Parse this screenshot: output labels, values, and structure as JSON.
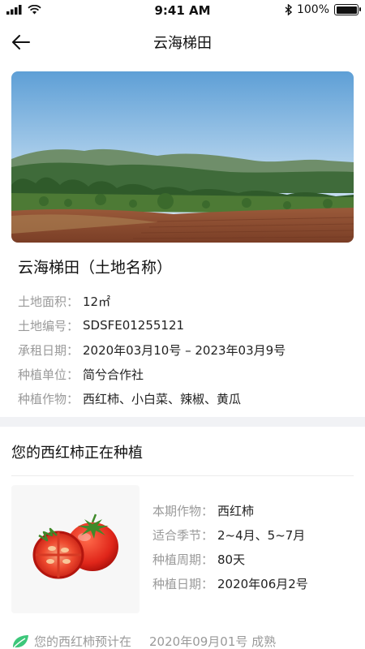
{
  "status": {
    "time": "9:41 AM",
    "battery": "100%",
    "battery_level": 1.0,
    "icons": [
      "signal-icon",
      "wifi-icon",
      "bluetooth-icon",
      "battery-icon"
    ]
  },
  "nav": {
    "title": "云海梯田",
    "back_icon": "back-arrow-icon"
  },
  "land": {
    "title": "云海梯田（土地名称）",
    "fields": [
      {
        "label": "土地面积：",
        "value": "12㎡"
      },
      {
        "label": "土地编号：",
        "value": "SDSFE01255121"
      },
      {
        "label": "承租日期：",
        "value": "2020年03月10号 – 2023年03月9号"
      },
      {
        "label": "种植单位：",
        "value": "简兮合作社"
      },
      {
        "label": "种植作物：",
        "value": "西红柿、小白菜、辣椒、黄瓜"
      }
    ]
  },
  "crop": {
    "heading": "您的西红柿正在种植",
    "fields": [
      {
        "label": "本期作物：",
        "value": "西红柿"
      },
      {
        "label": "适合季节：",
        "value": "2~4月、5~7月"
      },
      {
        "label": "种植周期：",
        "value": "80天"
      },
      {
        "label": "种植日期：",
        "value": "2020年06月2号"
      }
    ]
  },
  "notice": {
    "icon": "leaf-icon",
    "text": "您的西红柿预计在",
    "date": "2020年09月01号 成熟"
  },
  "colors": {
    "accent_green": "#3cc77a",
    "label_gray": "#9a9a9a",
    "divider": "#f1f2f5"
  }
}
